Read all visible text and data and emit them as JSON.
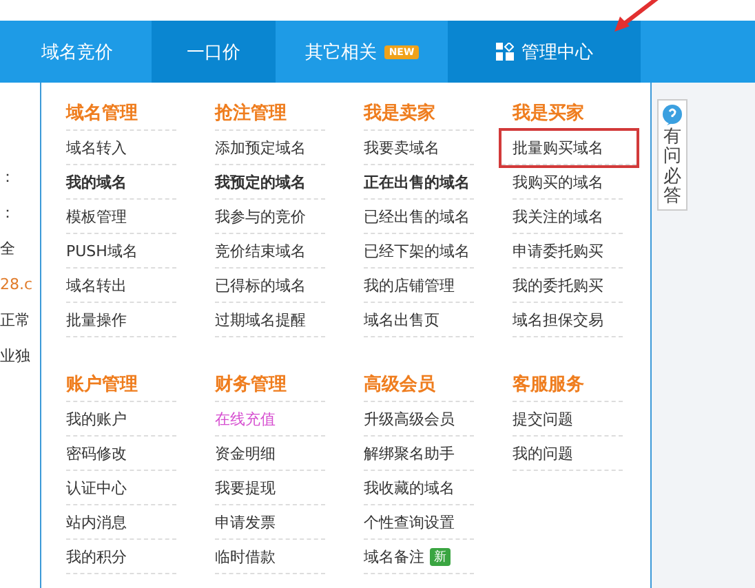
{
  "nav": {
    "tabs": [
      {
        "label": "域名竞价",
        "selected": false
      },
      {
        "label": "一口价",
        "selected": true
      },
      {
        "label": "其它相关",
        "badge": "NEW",
        "selected": false
      },
      {
        "label": "管理中心",
        "icon": true,
        "selected": true
      }
    ]
  },
  "background_page": {
    "fragments": [
      "：",
      "：",
      "全",
      "28.c",
      "正常",
      "业独"
    ]
  },
  "menu": {
    "sections": [
      {
        "columns": [
          {
            "title": "域名管理",
            "items": [
              {
                "label": "域名转入",
                "kind": "normal"
              },
              {
                "label": "我的域名",
                "kind": "bold"
              },
              {
                "label": "模板管理",
                "kind": "normal"
              },
              {
                "label": "PUSH域名",
                "kind": "normal"
              },
              {
                "label": "域名转出",
                "kind": "normal"
              },
              {
                "label": "批量操作",
                "kind": "normal"
              }
            ]
          },
          {
            "title": "抢注管理",
            "items": [
              {
                "label": "添加预定域名",
                "kind": "normal"
              },
              {
                "label": "我预定的域名",
                "kind": "bold"
              },
              {
                "label": "我参与的竞价",
                "kind": "normal"
              },
              {
                "label": "竞价结束域名",
                "kind": "normal"
              },
              {
                "label": "已得标的域名",
                "kind": "normal"
              },
              {
                "label": "过期域名提醒",
                "kind": "normal"
              }
            ]
          },
          {
            "title": "我是卖家",
            "items": [
              {
                "label": "我要卖域名",
                "kind": "normal"
              },
              {
                "label": "正在出售的域名",
                "kind": "bold"
              },
              {
                "label": "已经出售的域名",
                "kind": "normal"
              },
              {
                "label": "已经下架的域名",
                "kind": "normal"
              },
              {
                "label": "我的店铺管理",
                "kind": "normal"
              },
              {
                "label": "域名出售页",
                "kind": "normal"
              }
            ]
          },
          {
            "title": "我是买家",
            "items": [
              {
                "label": "批量购买域名",
                "kind": "normal",
                "highlighted": true
              },
              {
                "label": "我购买的域名",
                "kind": "normal"
              },
              {
                "label": "我关注的域名",
                "kind": "normal"
              },
              {
                "label": "申请委托购买",
                "kind": "normal"
              },
              {
                "label": "我的委托购买",
                "kind": "normal"
              },
              {
                "label": "域名担保交易",
                "kind": "normal"
              }
            ]
          }
        ]
      },
      {
        "columns": [
          {
            "title": "账户管理",
            "items": [
              {
                "label": "我的账户",
                "kind": "normal"
              },
              {
                "label": "密码修改",
                "kind": "normal"
              },
              {
                "label": "认证中心",
                "kind": "normal"
              },
              {
                "label": "站内消息",
                "kind": "normal"
              },
              {
                "label": "我的积分",
                "kind": "normal"
              }
            ]
          },
          {
            "title": "财务管理",
            "items": [
              {
                "label": "在线充值",
                "kind": "accent"
              },
              {
                "label": "资金明细",
                "kind": "normal"
              },
              {
                "label": "我要提现",
                "kind": "normal"
              },
              {
                "label": "申请发票",
                "kind": "normal"
              },
              {
                "label": "临时借款",
                "kind": "normal"
              }
            ]
          },
          {
            "title": "高级会员",
            "items": [
              {
                "label": "升级高级会员",
                "kind": "normal"
              },
              {
                "label": "解绑聚名助手",
                "kind": "normal"
              },
              {
                "label": "我收藏的域名",
                "kind": "normal"
              },
              {
                "label": "个性查询设置",
                "kind": "normal"
              },
              {
                "label": "域名备注",
                "kind": "normal",
                "badge": "新"
              }
            ]
          },
          {
            "title": "客服服务",
            "items": [
              {
                "label": "提交问题",
                "kind": "normal"
              },
              {
                "label": "我的问题",
                "kind": "normal"
              }
            ]
          }
        ]
      }
    ]
  },
  "help_widget": {
    "label": "有问必答"
  }
}
